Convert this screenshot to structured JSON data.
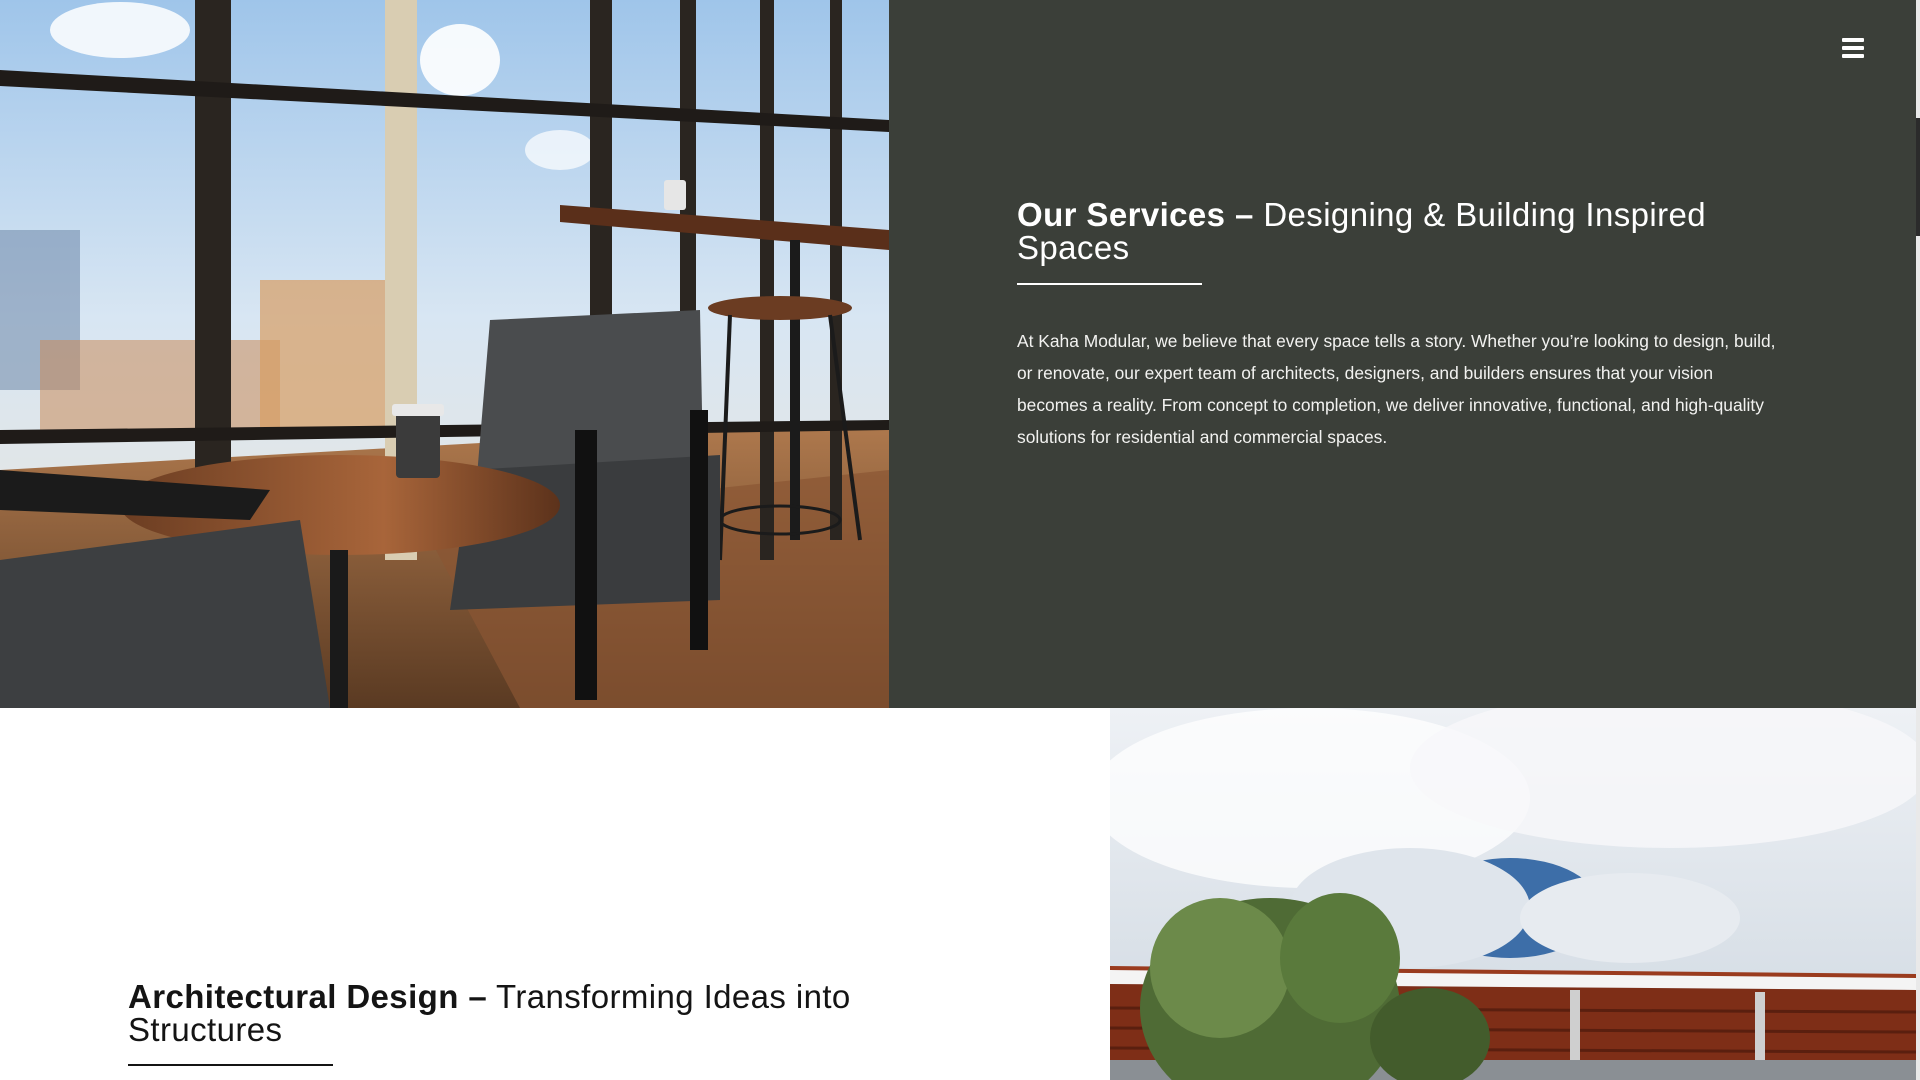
{
  "header": {
    "menu_icon": "hamburger-menu-icon"
  },
  "services": {
    "title_bold": "Our Services –",
    "title_rest": " Designing & Building Inspired Spaces",
    "description": "At Kaha Modular, we believe that every space tells a story. Whether you’re looking to design, build, or renovate, our expert team of architects, designers, and builders ensures that your vision becomes a reality. From concept to completion, we deliver innovative, functional, and high-quality solutions for residential and commercial spaces."
  },
  "architectural": {
    "title_bold": "Architectural Design –",
    "title_rest": " Transforming Ideas into Structures"
  },
  "colors": {
    "panel": "#3b3f39",
    "text_light": "#ffffff",
    "text_dark": "#141414"
  },
  "images": {
    "cafe": "cafe-interior-photo",
    "building": "building-exterior-photo"
  }
}
